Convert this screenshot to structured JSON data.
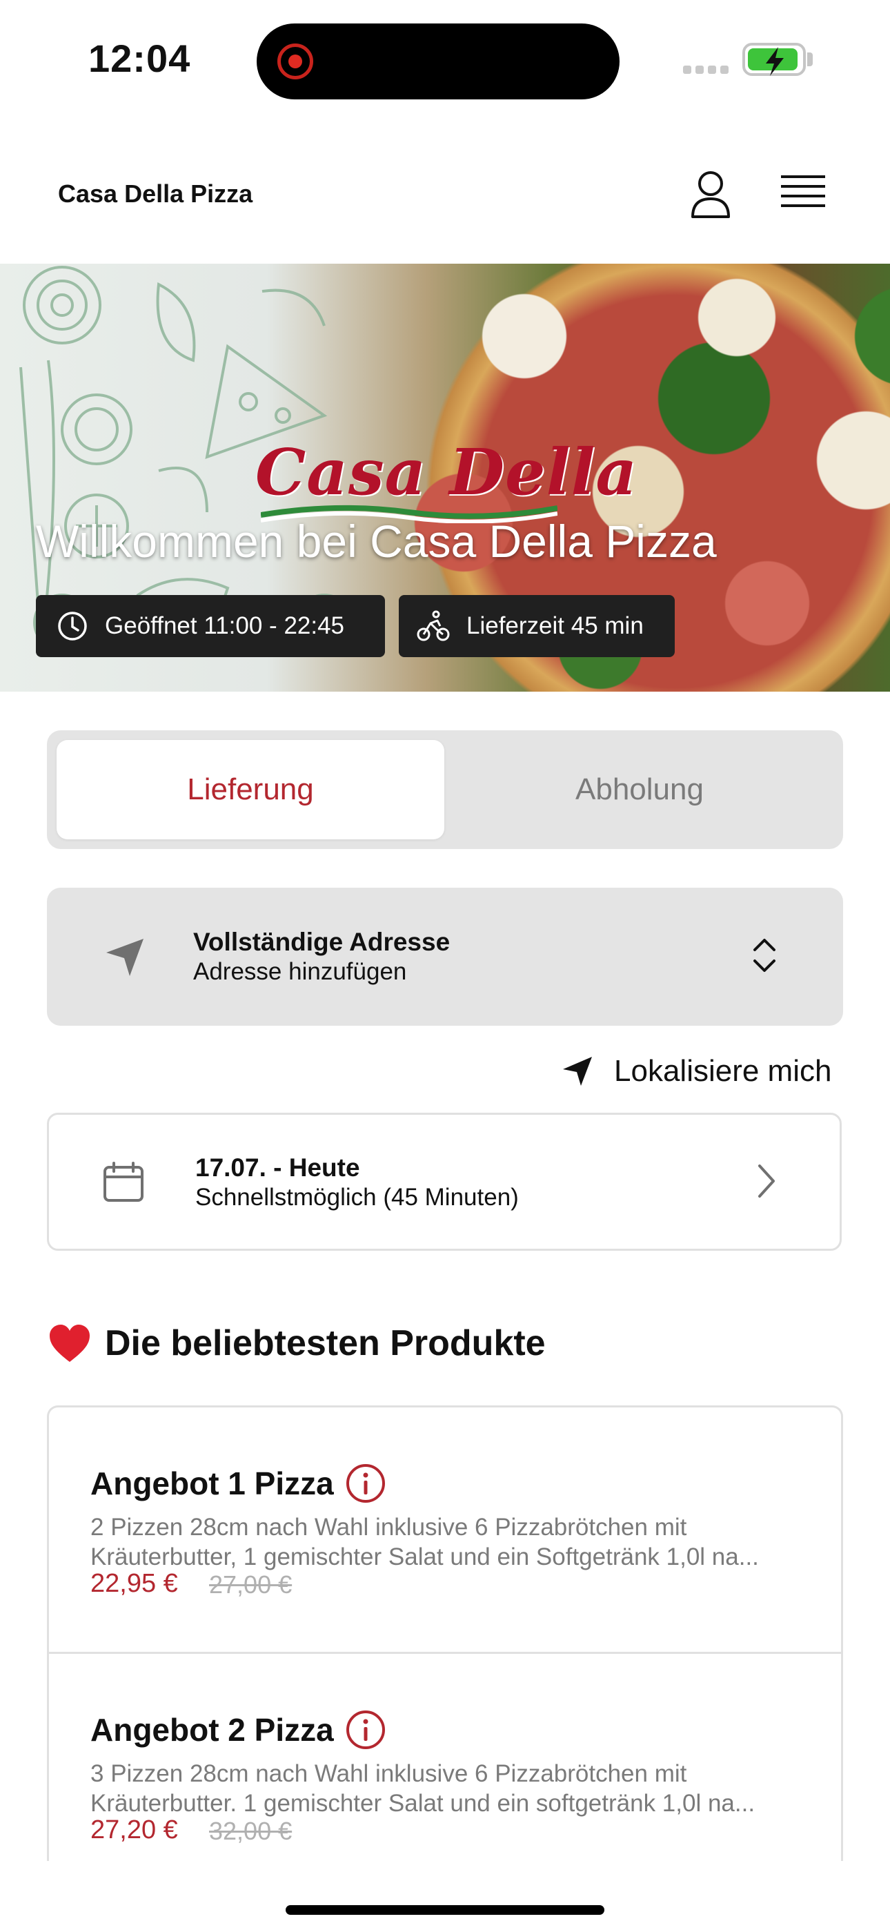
{
  "status_bar": {
    "time": "12:04"
  },
  "header": {
    "brand": "Casa Della Pizza"
  },
  "hero": {
    "logo_text": "Casa Della",
    "title": "Willkommen bei Casa Della Pizza",
    "opening_hours": "Geöffnet 11:00 - 22:45",
    "delivery_time": "Lieferzeit 45 min"
  },
  "order_mode": {
    "tabs": [
      {
        "label": "Lieferung",
        "selected": true
      },
      {
        "label": "Abholung",
        "selected": false
      }
    ]
  },
  "address": {
    "title": "Vollständige Adresse",
    "subtitle": "Adresse hinzufügen",
    "locate_label": "Lokalisiere mich"
  },
  "schedule": {
    "date": "17.07. - Heute",
    "slot": "Schnellstmöglich (45 Minuten)"
  },
  "popular": {
    "title": "Die beliebtesten Produkte",
    "products": [
      {
        "name": "Angebot 1 Pizza",
        "desc_line1": "2 Pizzen 28cm nach Wahl inklusive 6 Pizzabrötchen mit",
        "desc_line2": "Kräuterbutter, 1 gemischter Salat und ein Softgetränk 1,0l na...",
        "price": "22,95 €",
        "old_price": "27,00 €"
      },
      {
        "name": "Angebot 2 Pizza",
        "desc_line1": "3 Pizzen 28cm nach Wahl inklusive 6 Pizzabrötchen mit",
        "desc_line2": "Kräuterbutter. 1 gemischter Salat und ein softgetränk 1,0l na...",
        "price": "27,20 €",
        "old_price": "32,00 €"
      }
    ]
  },
  "colors": {
    "accent": "#b3272f",
    "chip_bg": "#202020",
    "card_bg": "#e4e4e4"
  },
  "icons": [
    "record-icon",
    "battery-charging-icon",
    "user-icon",
    "menu-icon",
    "clock-icon",
    "bicycle-icon",
    "navigation-arrow-icon",
    "chevron-updown-icon",
    "location-arrow-icon",
    "calendar-icon",
    "chevron-right-icon",
    "heart-icon",
    "info-icon"
  ]
}
